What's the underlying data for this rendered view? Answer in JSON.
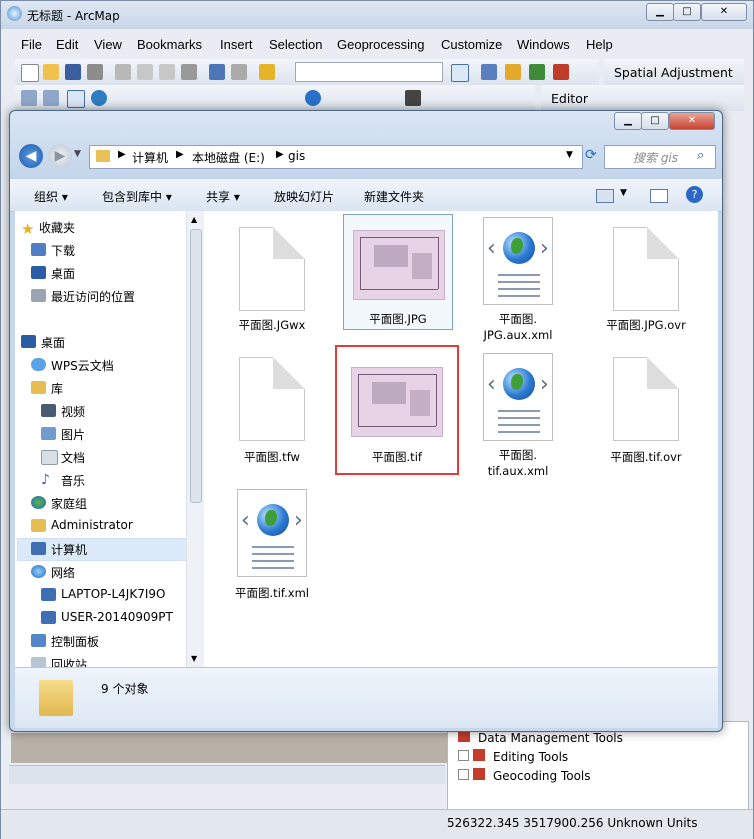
{
  "arcmap": {
    "title": "无标题 - ArcMap",
    "menu": [
      "File",
      "Edit",
      "View",
      "Bookmarks",
      "Insert",
      "Selection",
      "Geoprocessing",
      "Customize",
      "Windows",
      "Help"
    ],
    "spatial_adjustment": "Spatial Adjustment",
    "editor": "Editor",
    "toolbox_items": [
      "Data Management Tools",
      "Editing Tools",
      "Geocoding Tools"
    ],
    "coordinates": "526322.345  3517900.256 Unknown Units"
  },
  "explorer": {
    "breadcrumb": [
      "计算机",
      "本地磁盘 (E:)",
      "gis"
    ],
    "search_placeholder": "搜索 gis",
    "commands": [
      "组织",
      "包含到库中",
      "共享",
      "放映幻灯片",
      "新建文件夹"
    ],
    "nav": {
      "favorites_header": "收藏夹",
      "favorites": [
        "下载",
        "桌面",
        "最近访问的位置"
      ],
      "desktop": "桌面",
      "items": [
        "WPS云文档",
        "库",
        "视频",
        "图片",
        "文档",
        "音乐",
        "家庭组",
        "Administrator",
        "计算机",
        "网络",
        "LAPTOP-L4JK7I9O",
        "USER-20140909PT",
        "控制面板",
        "回收站"
      ]
    },
    "files": [
      {
        "name": "平面图.JGwx",
        "kind": "blank"
      },
      {
        "name": "平面图.JPG",
        "kind": "image"
      },
      {
        "name": "平面图.\nJPG.aux.xml",
        "kind": "xml"
      },
      {
        "name": "平面图.JPG.ovr",
        "kind": "blank"
      },
      {
        "name": "平面图.tfw",
        "kind": "blank"
      },
      {
        "name": "平面图.tif",
        "kind": "image"
      },
      {
        "name": "平面图.\ntif.aux.xml",
        "kind": "xml"
      },
      {
        "name": "平面图.tif.ovr",
        "kind": "blank"
      },
      {
        "name": "平面图.tif.xml",
        "kind": "xml"
      }
    ],
    "status_count": "9 个对象"
  },
  "colors": {
    "highlight": "#e03c3c",
    "selected_bg": "#dbeaf9"
  }
}
